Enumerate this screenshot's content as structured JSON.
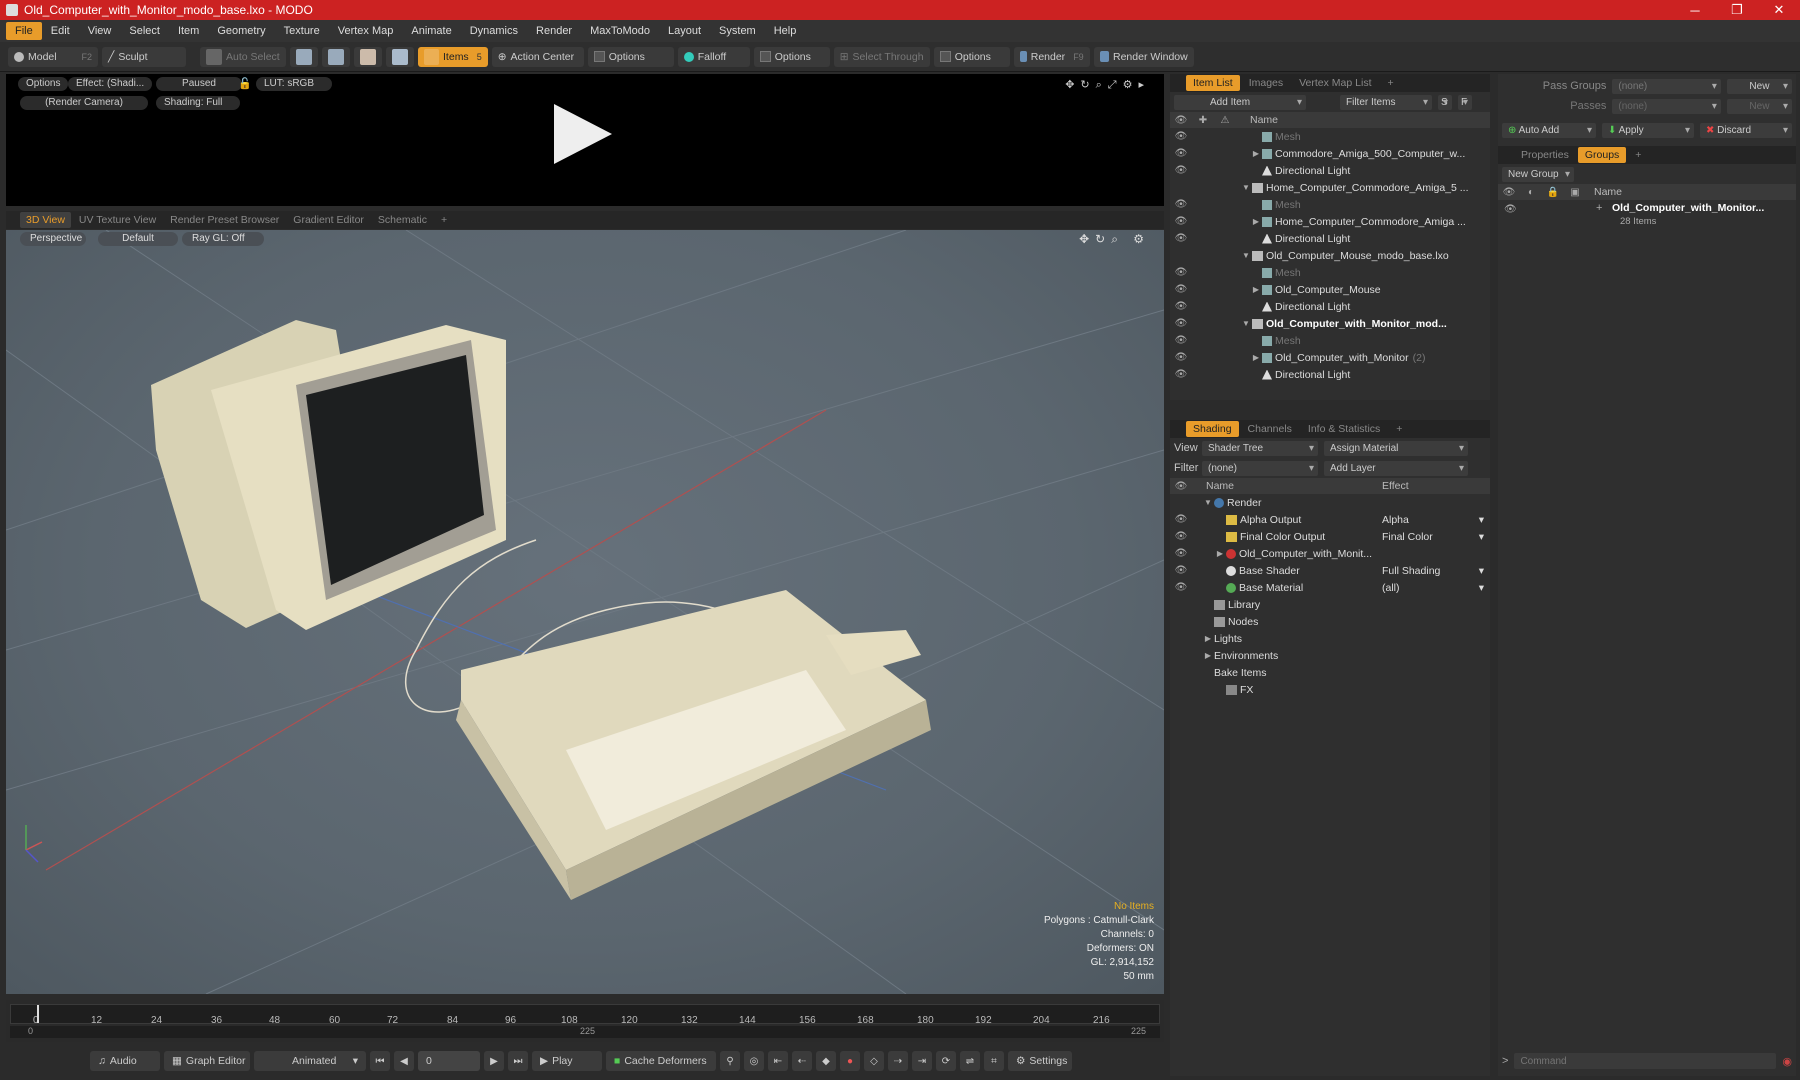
{
  "window": {
    "title": "Old_Computer_with_Monitor_modo_base.lxo - MODO",
    "minimize": "─",
    "maximize": "❐",
    "close": "✕"
  },
  "menu": [
    "File",
    "Edit",
    "View",
    "Select",
    "Item",
    "Geometry",
    "Texture",
    "Vertex Map",
    "Animate",
    "Dynamics",
    "Render",
    "MaxToModo",
    "Layout",
    "System",
    "Help"
  ],
  "toolbar": {
    "model": "Model",
    "model_key": "F2",
    "sculpt": "Sculpt",
    "auto_select": "Auto Select",
    "items": "Items",
    "items_key": "5",
    "action_center": "Action Center",
    "options1": "Options",
    "falloff": "Falloff",
    "options2": "Options",
    "select_through": "Select Through",
    "options3": "Options",
    "render": "Render",
    "render_key": "F9",
    "render_window": "Render Window"
  },
  "render_preview": {
    "options": "Options",
    "effect": "Effect: (Shadi...",
    "paused": "Paused",
    "lut": "LUT: sRGB",
    "camera": "(Render Camera)",
    "shading": "Shading: Full"
  },
  "viewport_tabs": [
    "3D View",
    "UV Texture View",
    "Render Preset Browser",
    "Gradient Editor",
    "Schematic",
    "+"
  ],
  "viewport": {
    "perspective": "Perspective",
    "default": "Default",
    "raygl": "Ray GL: Off"
  },
  "stats": {
    "no_items": "No Items",
    "polygons": "Polygons : Catmull-Clark",
    "channels": "Channels: 0",
    "deformers": "Deformers: ON",
    "gl": "GL: 2,914,152",
    "size": "50 mm"
  },
  "timeline": {
    "ticks": [
      "0",
      "12",
      "24",
      "36",
      "48",
      "60",
      "72",
      "84",
      "96",
      "108",
      "120",
      "132",
      "144",
      "156",
      "168",
      "180",
      "192",
      "204",
      "216"
    ],
    "start": "0",
    "mid": "225",
    "end": "225"
  },
  "bottom": {
    "audio": "Audio",
    "graph_editor": "Graph Editor",
    "animated": "Animated",
    "frame": "0",
    "play": "Play",
    "cache_deformers": "Cache Deformers",
    "settings": "Settings"
  },
  "item_list": {
    "tabs": [
      "Item List",
      "Images",
      "Vertex Map List",
      "+"
    ],
    "add_item": "Add Item",
    "filter_items": "Filter Items",
    "s": "S",
    "f": "F",
    "name_col": "Name",
    "rows": [
      {
        "label": "Mesh",
        "dim": true
      },
      {
        "label": "Commodore_Amiga_500_Computer_w..."
      },
      {
        "label": "Directional Light"
      },
      {
        "label": "Home_Computer_Commodore_Amiga_5 ..."
      },
      {
        "label": "Mesh",
        "dim": true
      },
      {
        "label": "Home_Computer_Commodore_Amiga ..."
      },
      {
        "label": "Directional Light"
      },
      {
        "label": "Old_Computer_Mouse_modo_base.lxo"
      },
      {
        "label": "Mesh",
        "dim": true
      },
      {
        "label": "Old_Computer_Mouse"
      },
      {
        "label": "Directional Light"
      },
      {
        "label": "Old_Computer_with_Monitor_mod..."
      },
      {
        "label": "Mesh",
        "dim": true
      },
      {
        "label": "Old_Computer_with_Monitor",
        "extra": "(2)"
      },
      {
        "label": "Directional Light"
      }
    ]
  },
  "shading": {
    "tabs": [
      "Shading",
      "Channels",
      "Info & Statistics",
      "+"
    ],
    "view_label": "View",
    "view_value": "Shader Tree",
    "assign_material": "Assign Material",
    "filter_label": "Filter",
    "filter_value": "(none)",
    "add_layer": "Add Layer",
    "name_col": "Name",
    "effect_col": "Effect",
    "rows": [
      {
        "label": "Render",
        "effect": ""
      },
      {
        "label": "Alpha Output",
        "effect": "Alpha"
      },
      {
        "label": "Final Color Output",
        "effect": "Final Color"
      },
      {
        "label": "Old_Computer_with_Monit...",
        "effect": ""
      },
      {
        "label": "Base Shader",
        "effect": "Full Shading"
      },
      {
        "label": "Base Material",
        "effect": "(all)"
      },
      {
        "label": "Library",
        "effect": ""
      },
      {
        "label": "Nodes",
        "effect": ""
      },
      {
        "label": "Lights",
        "effect": ""
      },
      {
        "label": "Environments",
        "effect": ""
      },
      {
        "label": "Bake Items",
        "effect": ""
      },
      {
        "label": "FX",
        "effect": ""
      }
    ]
  },
  "groups": {
    "pass_groups": "Pass Groups",
    "pass_value": "(none)",
    "new": "New",
    "passes": "Passes",
    "passes_value": "(none)",
    "new2": "New",
    "auto_add": "Auto Add",
    "apply": "Apply",
    "discard": "Discard",
    "tabs": [
      "Properties",
      "Groups",
      "+"
    ],
    "new_group": "New Group",
    "name_col": "Name",
    "item_name": "Old_Computer_with_Monitor...",
    "item_count": "28 Items"
  },
  "command": {
    "placeholder": "Command"
  },
  "colors": {
    "accent": "#e89c2a",
    "titlebar": "#cc2222"
  }
}
